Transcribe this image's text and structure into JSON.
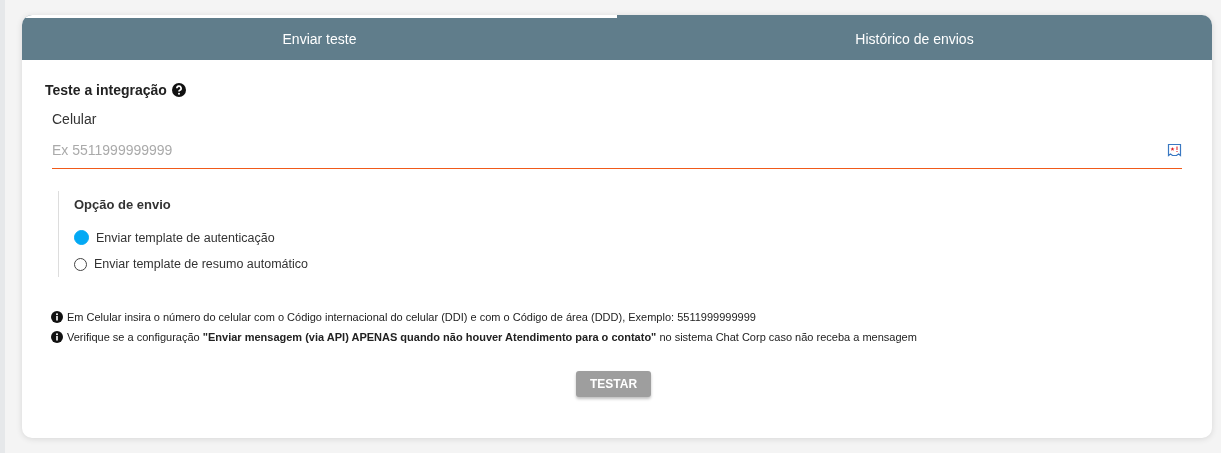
{
  "tabs": [
    {
      "label": "Enviar teste",
      "selected": true
    },
    {
      "label": "Histórico de envios",
      "selected": false
    }
  ],
  "section": {
    "title": "Teste a integração"
  },
  "phone_field": {
    "label": "Celular",
    "placeholder": "Ex 5511999999999"
  },
  "send_option": {
    "title": "Opção de envio",
    "options": [
      {
        "label": "Enviar template de autenticação",
        "selected": true
      },
      {
        "label": "Enviar template de resumo automático",
        "selected": false
      }
    ]
  },
  "notes": [
    "Em Celular insira o número do celular com o Código internacional do celular (DDI) e com o Código de área (DDD), Exemplo: 5511999999999",
    "Verifique se a configuração **\"Enviar mensagem (via API) APENAS quando não houver Atendimento para o contato\"** no sistema Chat Corp caso não receba a mensagem"
  ],
  "test_button": {
    "label": "TESTAR",
    "disabled": true
  }
}
